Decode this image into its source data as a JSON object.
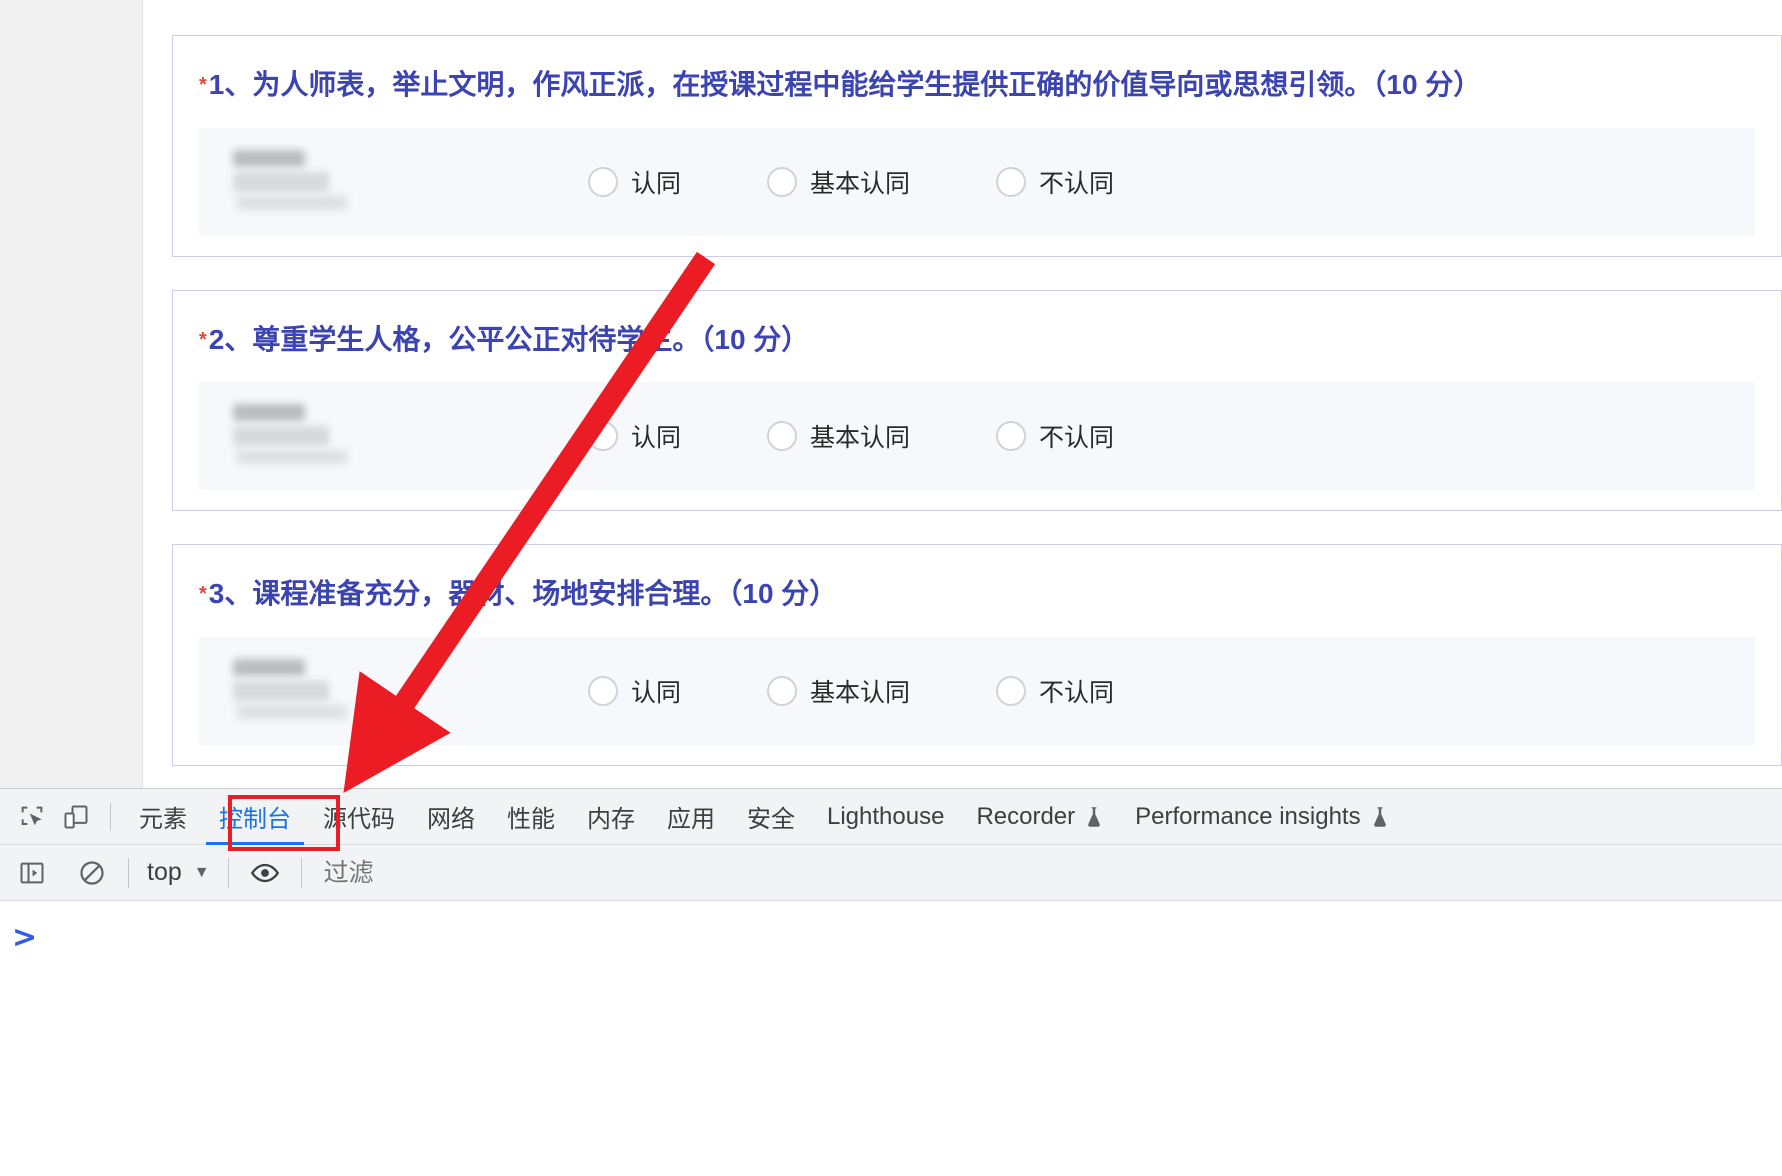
{
  "survey": {
    "questions": [
      {
        "required_marker": "*",
        "text": "1、为人师表，举止文明，作风正派，在授课过程中能给学生提供正确的价值导向或思想引领。（10 分）",
        "respondent_name_redacted": true,
        "options": [
          "认同",
          "基本认同",
          "不认同"
        ],
        "selected": null
      },
      {
        "required_marker": "*",
        "text": "2、尊重学生人格，公平公正对待学生。（10 分）",
        "respondent_name_redacted": true,
        "options": [
          "认同",
          "基本认同",
          "不认同"
        ],
        "selected": null
      },
      {
        "required_marker": "*",
        "text": "3、课程准备充分，器材、场地安排合理。（10 分）",
        "respondent_name_redacted": true,
        "options": [
          "认同",
          "基本认同",
          "不认同"
        ],
        "selected": null
      }
    ]
  },
  "devtools": {
    "toolbar_icons": [
      {
        "name": "inspect-element-icon"
      },
      {
        "name": "device-toolbar-icon"
      }
    ],
    "tabs": [
      {
        "label": "元素",
        "active": false,
        "experimental": false
      },
      {
        "label": "控制台",
        "active": true,
        "experimental": false
      },
      {
        "label": "源代码",
        "active": false,
        "experimental": false
      },
      {
        "label": "网络",
        "active": false,
        "experimental": false
      },
      {
        "label": "性能",
        "active": false,
        "experimental": false
      },
      {
        "label": "内存",
        "active": false,
        "experimental": false
      },
      {
        "label": "应用",
        "active": false,
        "experimental": false
      },
      {
        "label": "安全",
        "active": false,
        "experimental": false
      },
      {
        "label": "Lighthouse",
        "active": false,
        "experimental": false
      },
      {
        "label": "Recorder",
        "active": false,
        "experimental": true
      },
      {
        "label": "Performance insights",
        "active": false,
        "experimental": true
      }
    ],
    "console_toolbar": {
      "sidebar_toggle": "console-sidebar-icon",
      "clear_console": "clear-console-icon",
      "context_value": "top",
      "context_caret": "▼",
      "eye_icon": "live-expression-icon",
      "filter_placeholder": "过滤"
    },
    "console_prompt_symbol": ">"
  },
  "annotation": {
    "arrow_color": "#ec1c24",
    "highlight_box_color": "#ec1c24",
    "highlight_target": "控制台"
  },
  "colors": {
    "question_title": "#3b44b0",
    "required_asterisk": "#e8453c",
    "card_border": "#ccccea",
    "option_row_bg": "#f6f8fb",
    "devtools_chrome": "#f1f3f4",
    "active_tab": "#1a73e8",
    "console_prompt": "#2e5ce6"
  }
}
